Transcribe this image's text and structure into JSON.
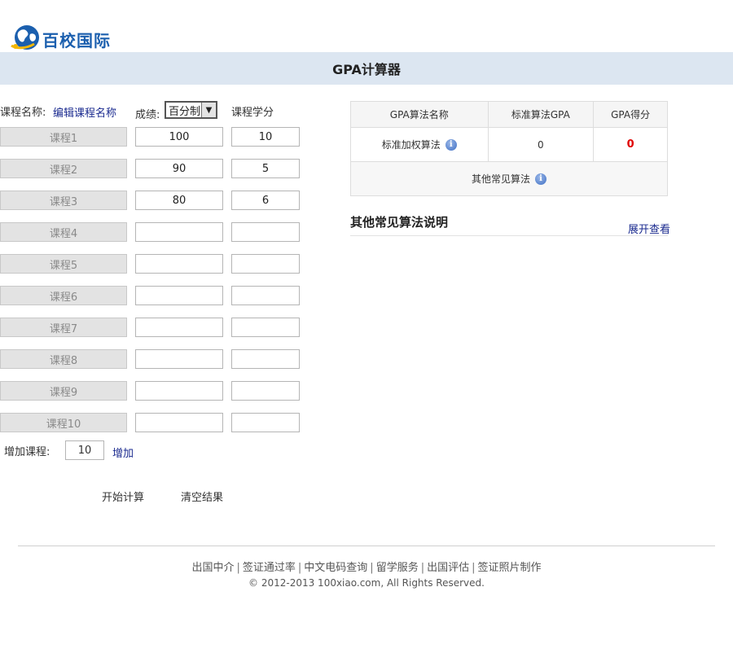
{
  "brand": {
    "name": "百校国际"
  },
  "page": {
    "title": "GPA计算器"
  },
  "form": {
    "course_name_label": "课程名称:",
    "edit_course_link": "编辑课程名称",
    "grade_label": "成绩:",
    "grade_system_selected": "百分制",
    "credit_label": "课程学分",
    "courses": [
      {
        "name": "课程1",
        "score": "100",
        "credit": "10"
      },
      {
        "name": "课程2",
        "score": "90",
        "credit": "5"
      },
      {
        "name": "课程3",
        "score": "80",
        "credit": "6"
      },
      {
        "name": "课程4",
        "score": "",
        "credit": ""
      },
      {
        "name": "课程5",
        "score": "",
        "credit": ""
      },
      {
        "name": "课程6",
        "score": "",
        "credit": ""
      },
      {
        "name": "课程7",
        "score": "",
        "credit": ""
      },
      {
        "name": "课程8",
        "score": "",
        "credit": ""
      },
      {
        "name": "课程9",
        "score": "",
        "credit": ""
      },
      {
        "name": "课程10",
        "score": "",
        "credit": ""
      }
    ],
    "add_course_label": "增加课程:",
    "add_course_count": "10",
    "add_link": "增加",
    "calculate_button": "开始计算",
    "clear_button": "清空结果"
  },
  "results": {
    "headers": [
      "GPA算法名称",
      "标准算法GPA",
      "GPA得分"
    ],
    "standard_method": "标准加权算法",
    "standard_gpa": "0",
    "gpa_score": "0",
    "other_methods": "其他常见算法",
    "score_color": "#e00000"
  },
  "other_section": {
    "title": "其他常见算法说明",
    "expand_link": "展开查看"
  },
  "footer": {
    "links": [
      "出国中介",
      "签证通过率",
      "中文电码查询",
      "留学服务",
      "出国评估",
      "签证照片制作"
    ],
    "copyright": "© 2012-2013 100xiao.com, All Rights Reserved."
  },
  "colors": {
    "title_bar": "#dce6f1",
    "link": "#1a2a8f",
    "brand_blue": "#1b5fae"
  }
}
